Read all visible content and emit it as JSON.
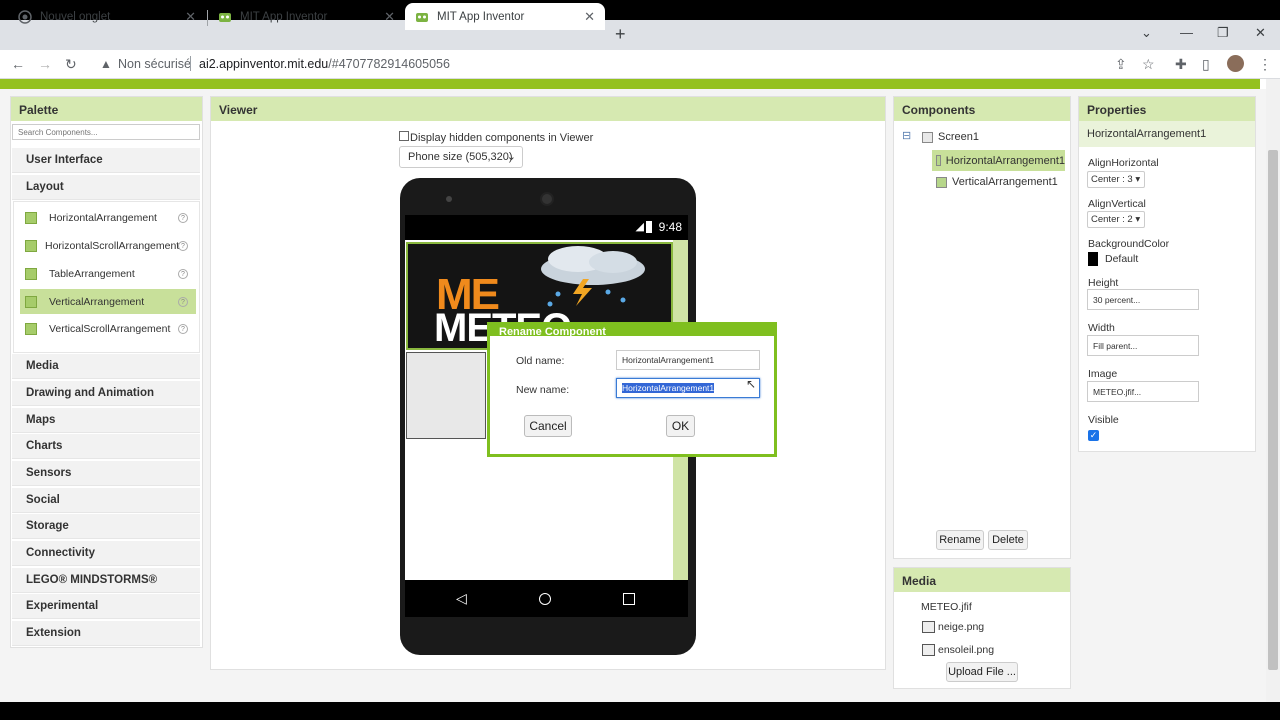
{
  "browser": {
    "tabs": [
      {
        "title": "Nouvel onglet",
        "active": false
      },
      {
        "title": "MIT App Inventor",
        "active": false
      },
      {
        "title": "MIT App Inventor",
        "active": true
      }
    ],
    "security_label": "Non sécurisé",
    "url_host": "ai2.appinventor.mit.edu",
    "url_path": "/#4707782914605056"
  },
  "palette": {
    "title": "Palette",
    "search_placeholder": "Search Components...",
    "categories_top": [
      "User Interface",
      "Layout"
    ],
    "layout_items": [
      {
        "label": "HorizontalArrangement",
        "selected": false
      },
      {
        "label": "HorizontalScrollArrangement",
        "selected": false
      },
      {
        "label": "TableArrangement",
        "selected": false
      },
      {
        "label": "VerticalArrangement",
        "selected": true
      },
      {
        "label": "VerticalScrollArrangement",
        "selected": false
      }
    ],
    "help_glyph": "?",
    "categories_bottom": [
      "Media",
      "Drawing and Animation",
      "Maps",
      "Charts",
      "Sensors",
      "Social",
      "Storage",
      "Connectivity",
      "LEGO® MINDSTORMS®",
      "Experimental",
      "Extension"
    ]
  },
  "viewer": {
    "title": "Viewer",
    "hidden_components_label": "Display hidden components in Viewer",
    "phone_size": "Phone size (505,320)",
    "status_time": "9:48",
    "logo_text_1": "ME",
    "logo_text_2": "METEO"
  },
  "dialog": {
    "title": "Rename Component",
    "old_name_label": "Old name:",
    "old_name_value": "HorizontalArrangement1",
    "new_name_label": "New name:",
    "new_name_value": "HorizontalArrangement1",
    "cancel": "Cancel",
    "ok": "OK"
  },
  "components": {
    "title": "Components",
    "tree": [
      {
        "label": "Screen1",
        "level": 0,
        "selected": false
      },
      {
        "label": "HorizontalArrangement1",
        "level": 1,
        "selected": true
      },
      {
        "label": "VerticalArrangement1",
        "level": 1,
        "selected": false
      }
    ],
    "collapse_glyph": "⊟",
    "rename": "Rename",
    "delete": "Delete"
  },
  "media": {
    "title": "Media",
    "files": [
      "METEO.jfif",
      "neige.png",
      "ensoleil.png"
    ],
    "upload": "Upload File ..."
  },
  "properties": {
    "title": "Properties",
    "component": "HorizontalArrangement1",
    "align_horizontal_label": "AlignHorizontal",
    "align_horizontal_value": "Center : 3 ▾",
    "align_vertical_label": "AlignVertical",
    "align_vertical_value": "Center : 2 ▾",
    "background_label": "BackgroundColor",
    "background_value": "Default",
    "height_label": "Height",
    "height_value": "30 percent...",
    "width_label": "Width",
    "width_value": "Fill parent...",
    "image_label": "Image",
    "image_value": "METEO.jfif...",
    "visible_label": "Visible",
    "visible_checked": true
  },
  "colors": {
    "accent_green": "#94c11f",
    "panel_header": "#d6e9b1",
    "selection_blue": "#3367d6"
  }
}
